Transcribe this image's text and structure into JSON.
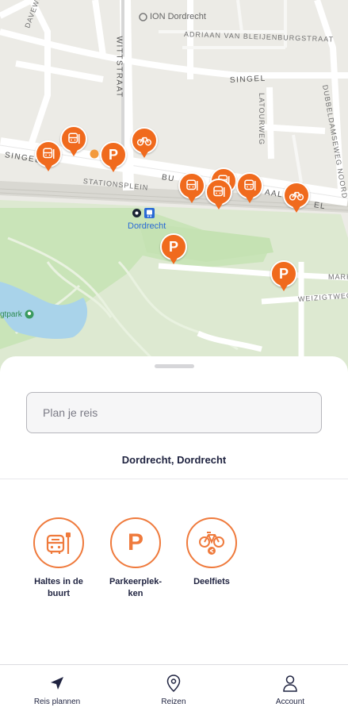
{
  "map": {
    "streets": {
      "wittstraat": "WITTSTRAAT",
      "bleijenburg": "ADRIAAN VAN BLEIJENBURGSTRAAT",
      "singel_top": "SINGEL",
      "singel_left": "SINGEL",
      "stationsplein": "STATIONSPLEIN",
      "bu": "BU",
      "aal": "AAL",
      "el": "EL",
      "latourweg": "LATOURWEG",
      "dubbeldamseweg": "DUBBELDAMSEWEG NOORD",
      "markt": "MARK",
      "weizigtweg": "WEIZIGTWEG",
      "top_left": "DAVEWEG"
    },
    "poi_ion": "ION Dordrecht",
    "station_label": "Dordrecht",
    "park_label": "gtpark",
    "parking_letter": "P"
  },
  "sheet": {
    "search_placeholder": "Plan je reis",
    "location": "Dordrecht, Dordrecht",
    "actions": [
      {
        "label_line1": "Haltes in de",
        "label_line2": "buurt",
        "icon": "bus-stop-icon"
      },
      {
        "label_line1": "Parkeerplek-",
        "label_line2": "ken",
        "icon": "parking-icon",
        "glyph": "P"
      },
      {
        "label_line1": "Deelfiets",
        "label_line2": "",
        "icon": "shared-bike-icon"
      }
    ]
  },
  "nav": {
    "tabs": [
      {
        "label": "Reis plannen",
        "icon": "navigation-arrow-icon"
      },
      {
        "label": "Reizen",
        "icon": "location-pin-icon"
      },
      {
        "label": "Account",
        "icon": "person-icon"
      }
    ]
  },
  "colors": {
    "accent": "#f06a1d",
    "text": "#1f2340",
    "park": "#c9e4b8",
    "water": "#a9d3ea"
  }
}
